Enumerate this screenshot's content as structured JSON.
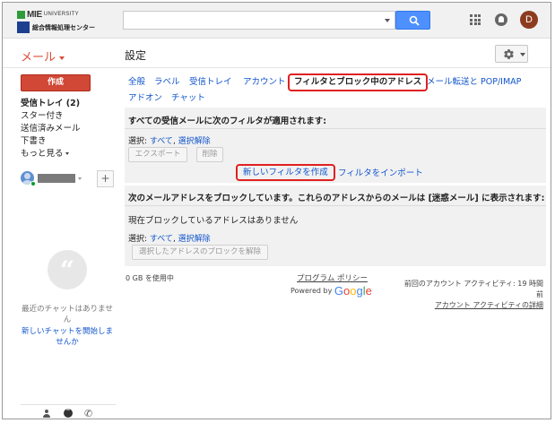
{
  "header": {
    "logo_mie": "MIE",
    "logo_university": "UNIVERSITY",
    "logo_center": "総合情報処理センター",
    "avatar_letter": "D"
  },
  "subheader": {
    "mail_label": "メール",
    "page_title": "設定"
  },
  "sidebar": {
    "compose": "作成",
    "items": [
      {
        "label": "受信トレイ (2)",
        "bold": true
      },
      {
        "label": "スター付き"
      },
      {
        "label": "送信済みメール"
      },
      {
        "label": "下書き"
      },
      {
        "label": "もっと見る"
      }
    ],
    "add_label": "+",
    "no_chat": "最近のチャットはありません",
    "start_chat": "新しいチャットを開始しませんか"
  },
  "tabs": [
    {
      "label": "全般"
    },
    {
      "label": "ラベル"
    },
    {
      "label": "受信トレイ"
    },
    {
      "label": "アカウント"
    },
    {
      "label": "フィルタとブロック中のアドレス",
      "active": true
    },
    {
      "label": "メール転送と POP/IMAP"
    },
    {
      "label": "アドオン"
    },
    {
      "label": "チャット"
    }
  ],
  "filters": {
    "title": "すべての受信メールに次のフィルタが適用されます:",
    "select_label": "選択:",
    "select_all": "すべて",
    "select_none": "選択解除",
    "export_button": "エクスポート",
    "delete_button": "削除",
    "create_filter": "新しいフィルタを作成",
    "import_filter": "フィルタをインポート"
  },
  "blocked": {
    "title": "次のメールアドレスをブロックしています。これらのアドレスからのメールは [迷惑メール] に表示されます:",
    "empty": "現在ブロックしているアドレスはありません",
    "select_label": "選択:",
    "select_all": "すべて",
    "select_none": "選択解除",
    "unblock_button": "選択したアドレスのブロックを解除"
  },
  "footer": {
    "usage": "0 GB を使用中",
    "policy": "プログラム ポリシー",
    "powered_by": "Powered by",
    "google": "Google",
    "activity": "前回のアカウント アクティビティ: 19 時間前",
    "details": "アカウント アクティビティの詳細"
  },
  "colors": {
    "accent": "#dd4b39",
    "link": "#1155cc",
    "highlight": "#e02020",
    "search": "#4d90fe"
  }
}
